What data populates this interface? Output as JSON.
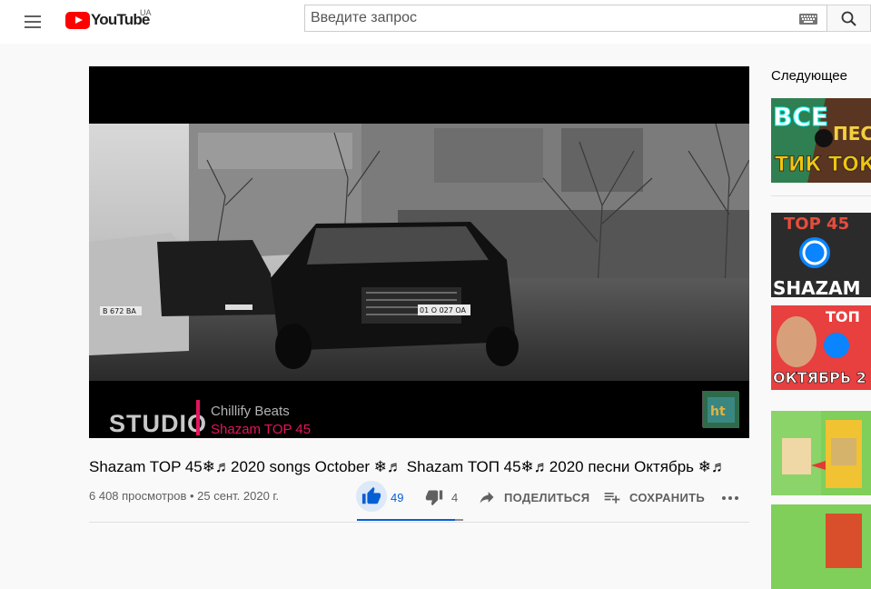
{
  "header": {
    "logo_text": "YouTube",
    "region": "UA",
    "search_placeholder": "Введите запрос"
  },
  "player": {
    "studio_text": "STUDIO",
    "credit_line1": "Chillify Beats",
    "credit_line2": "Shazam TOP 45",
    "plates": [
      "B 672 BA",
      "01 O 027 OA"
    ]
  },
  "video": {
    "title": "Shazam TOP 45❄♬2020 songs October ❄♬ Shazam ТОП 45❄♬2020 песни Октябрь ❄♬",
    "views": "6 408 просмотров",
    "date": "25 сент. 2020 г.",
    "like_count": "49",
    "dislike_count": "4",
    "share_label": "ПОДЕЛИТЬСЯ",
    "save_label": "СОХРАНИТЬ",
    "like_ratio": 0.92
  },
  "sidebar": {
    "up_next_label": "Следующее",
    "thumbs": [
      {
        "lines": [
          "ВСЕ",
          "ПЕС",
          "ТИК ТОК"
        ]
      },
      {
        "lines": [
          "ТОР 45",
          "SHAZAM"
        ]
      },
      {
        "lines": [
          "ТОП",
          "ОКТЯБРЬ 2"
        ]
      },
      {
        "lines": []
      },
      {
        "lines": []
      }
    ]
  },
  "colors": {
    "accent_like": "#065fd4",
    "brand_red": "#ff0000",
    "credit_pink": "#e6135e"
  }
}
